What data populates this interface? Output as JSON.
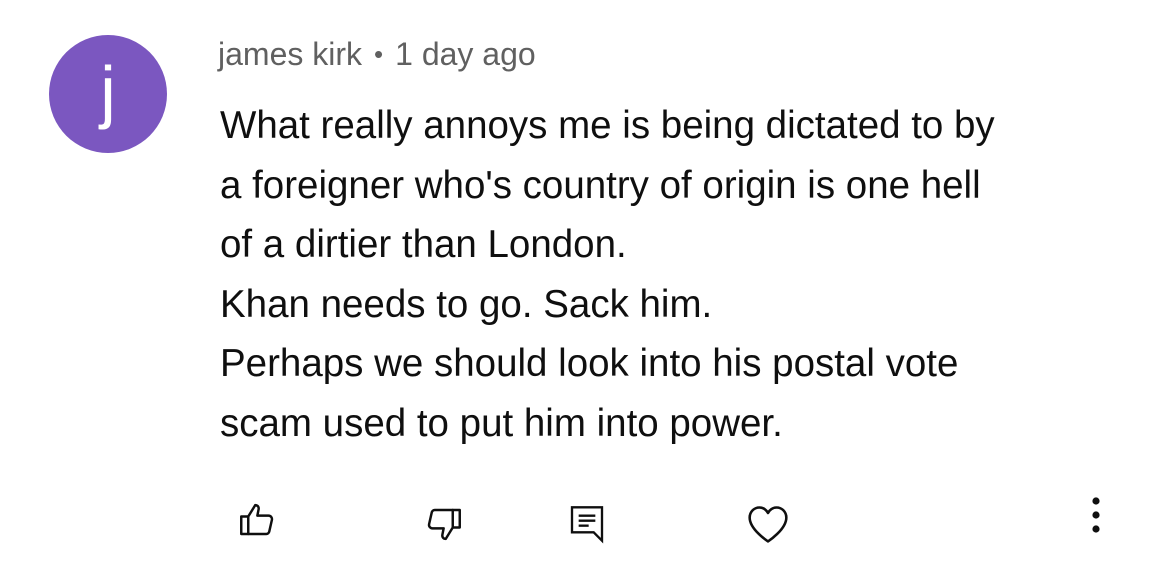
{
  "comment": {
    "avatar_letter": "j",
    "avatar_color": "#7b57c0",
    "author": "james kirk",
    "separator": "•",
    "timestamp": "1 day ago",
    "lines": [
      "What really annoys me is being dictated to by",
      "a foreigner who's country of origin is one hell",
      "of a dirtier than London.",
      "Khan needs to go. Sack him.",
      "Perhaps we should look into his postal vote",
      "scam used to put him into power."
    ]
  },
  "actions": {
    "icons": [
      "thumbs-up-icon",
      "thumbs-down-icon",
      "reply-icon",
      "heart-icon",
      "more-vertical-icon"
    ]
  }
}
